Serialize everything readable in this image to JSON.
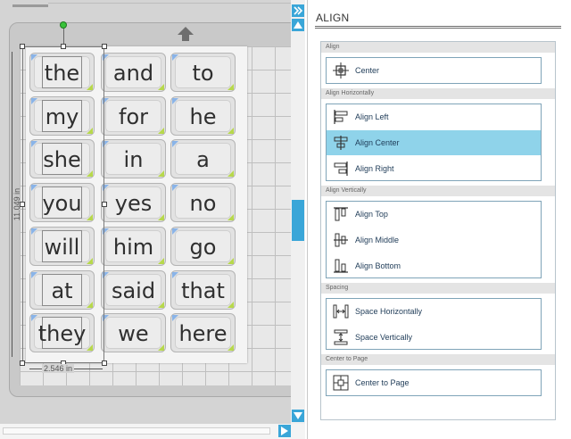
{
  "panel": {
    "title": "ALIGN",
    "sections": [
      {
        "header": "Align",
        "items": [
          {
            "label": "Center",
            "icon": "center-icon"
          }
        ]
      },
      {
        "header": "Align Horizontally",
        "items": [
          {
            "label": "Align Left",
            "icon": "align-left-icon"
          },
          {
            "label": "Align Center",
            "icon": "align-center-icon",
            "active": true
          },
          {
            "label": "Align Right",
            "icon": "align-right-icon"
          }
        ]
      },
      {
        "header": "Align Vertically",
        "items": [
          {
            "label": "Align Top",
            "icon": "align-top-icon"
          },
          {
            "label": "Align Middle",
            "icon": "align-middle-icon"
          },
          {
            "label": "Align Bottom",
            "icon": "align-bottom-icon"
          }
        ]
      },
      {
        "header": "Spacing",
        "items": [
          {
            "label": "Space Horizontally",
            "icon": "space-horizontally-icon"
          },
          {
            "label": "Space Vertically",
            "icon": "space-vertically-icon"
          }
        ]
      },
      {
        "header": "Center to Page",
        "items": [
          {
            "label": "Center to Page",
            "icon": "center-to-page-icon"
          }
        ]
      }
    ]
  },
  "canvas": {
    "words": [
      [
        "the",
        "and",
        "to"
      ],
      [
        "my",
        "for",
        "he"
      ],
      [
        "she",
        "in",
        "a"
      ],
      [
        "you",
        "yes",
        "no"
      ],
      [
        "will",
        "him",
        "go"
      ],
      [
        "at",
        "said",
        "that"
      ],
      [
        "they",
        "we",
        "here"
      ]
    ],
    "height_label": "11.049 in",
    "width_label": "2.546 in"
  },
  "colors": {
    "accent": "#3aa6d8",
    "active_item": "#8fd3ea",
    "item_text": "#1e3b57"
  }
}
